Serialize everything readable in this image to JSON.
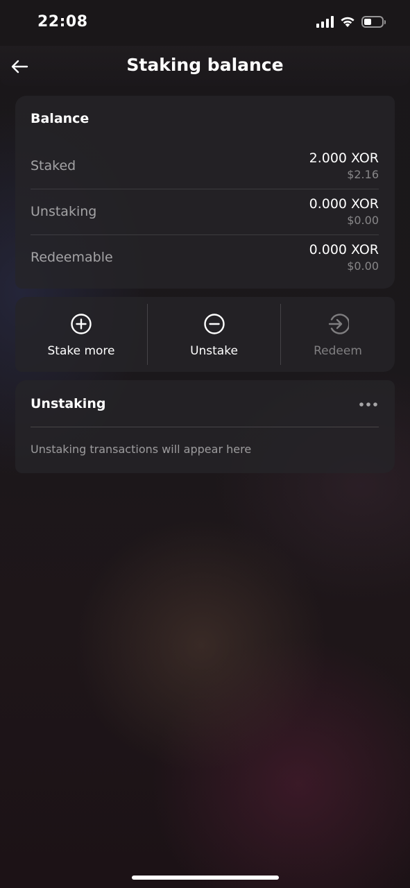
{
  "status_bar": {
    "time": "22:08",
    "battery_level": 0.4
  },
  "header": {
    "title": "Staking balance",
    "back_icon": "arrow-left-icon"
  },
  "balance": {
    "title": "Balance",
    "rows": [
      {
        "label": "Staked",
        "amount": "2.000 XOR",
        "fiat": "$2.16"
      },
      {
        "label": "Unstaking",
        "amount": "0.000 XOR",
        "fiat": "$0.00"
      },
      {
        "label": "Redeemable",
        "amount": "0.000 XOR",
        "fiat": "$0.00"
      }
    ]
  },
  "actions": [
    {
      "label": "Stake more",
      "icon": "plus-circle-icon",
      "enabled": true
    },
    {
      "label": "Unstake",
      "icon": "minus-circle-icon",
      "enabled": true
    },
    {
      "label": "Redeem",
      "icon": "arrow-right-circle-icon",
      "enabled": false
    }
  ],
  "unstaking": {
    "title": "Unstaking",
    "more_icon": "more-horizontal-icon",
    "empty_message": "Unstaking transactions will appear here"
  },
  "colors": {
    "background": "#1b181b",
    "card": "#262428",
    "text_primary": "#ffffff",
    "text_secondary": "#8e8c90"
  }
}
